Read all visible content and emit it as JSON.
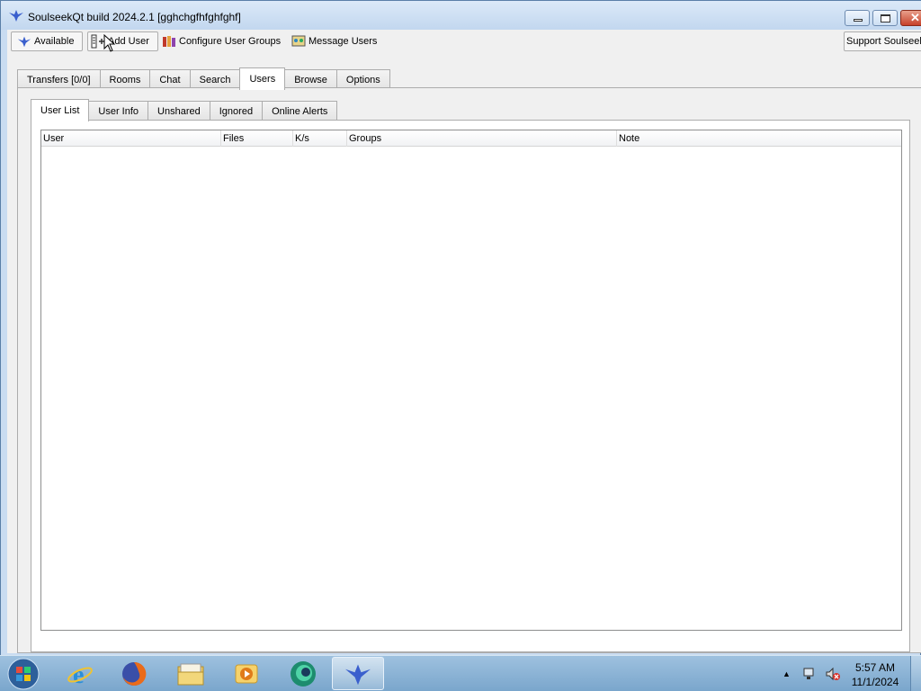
{
  "window": {
    "title": "SoulseekQt build 2024.2.1 [gghchgfhfghfghf]",
    "controls": {
      "minimize": "—",
      "maximize": "▢",
      "close": "✕"
    }
  },
  "toolbar": {
    "status_label": "Available",
    "add_user_label": "Add User",
    "configure_groups_label": "Configure User Groups",
    "message_users_label": "Message Users",
    "support_label": "Support Soulseek"
  },
  "main_tabs": [
    {
      "label": "Transfers [0/0]",
      "active": false
    },
    {
      "label": "Rooms",
      "active": false
    },
    {
      "label": "Chat",
      "active": false
    },
    {
      "label": "Search",
      "active": false
    },
    {
      "label": "Users",
      "active": true
    },
    {
      "label": "Browse",
      "active": false
    },
    {
      "label": "Options",
      "active": false
    }
  ],
  "sub_tabs": [
    {
      "label": "User List",
      "active": true
    },
    {
      "label": "User Info",
      "active": false
    },
    {
      "label": "Unshared",
      "active": false
    },
    {
      "label": "Ignored",
      "active": false
    },
    {
      "label": "Online Alerts",
      "active": false
    }
  ],
  "user_table": {
    "columns": [
      "User",
      "Files",
      "K/s",
      "Groups",
      "Note"
    ],
    "rows": []
  },
  "taskbar": {
    "apps": [
      "internet-explorer",
      "firefox",
      "file-explorer",
      "media-player",
      "browser-globe",
      "soulseek"
    ],
    "clock_time": "5:57 AM",
    "clock_date": "11/1/2024"
  },
  "colors": {
    "accent": "#3a5fcd",
    "taskbar": "#8fb6d9",
    "window_frame": "#c9dcf1"
  }
}
